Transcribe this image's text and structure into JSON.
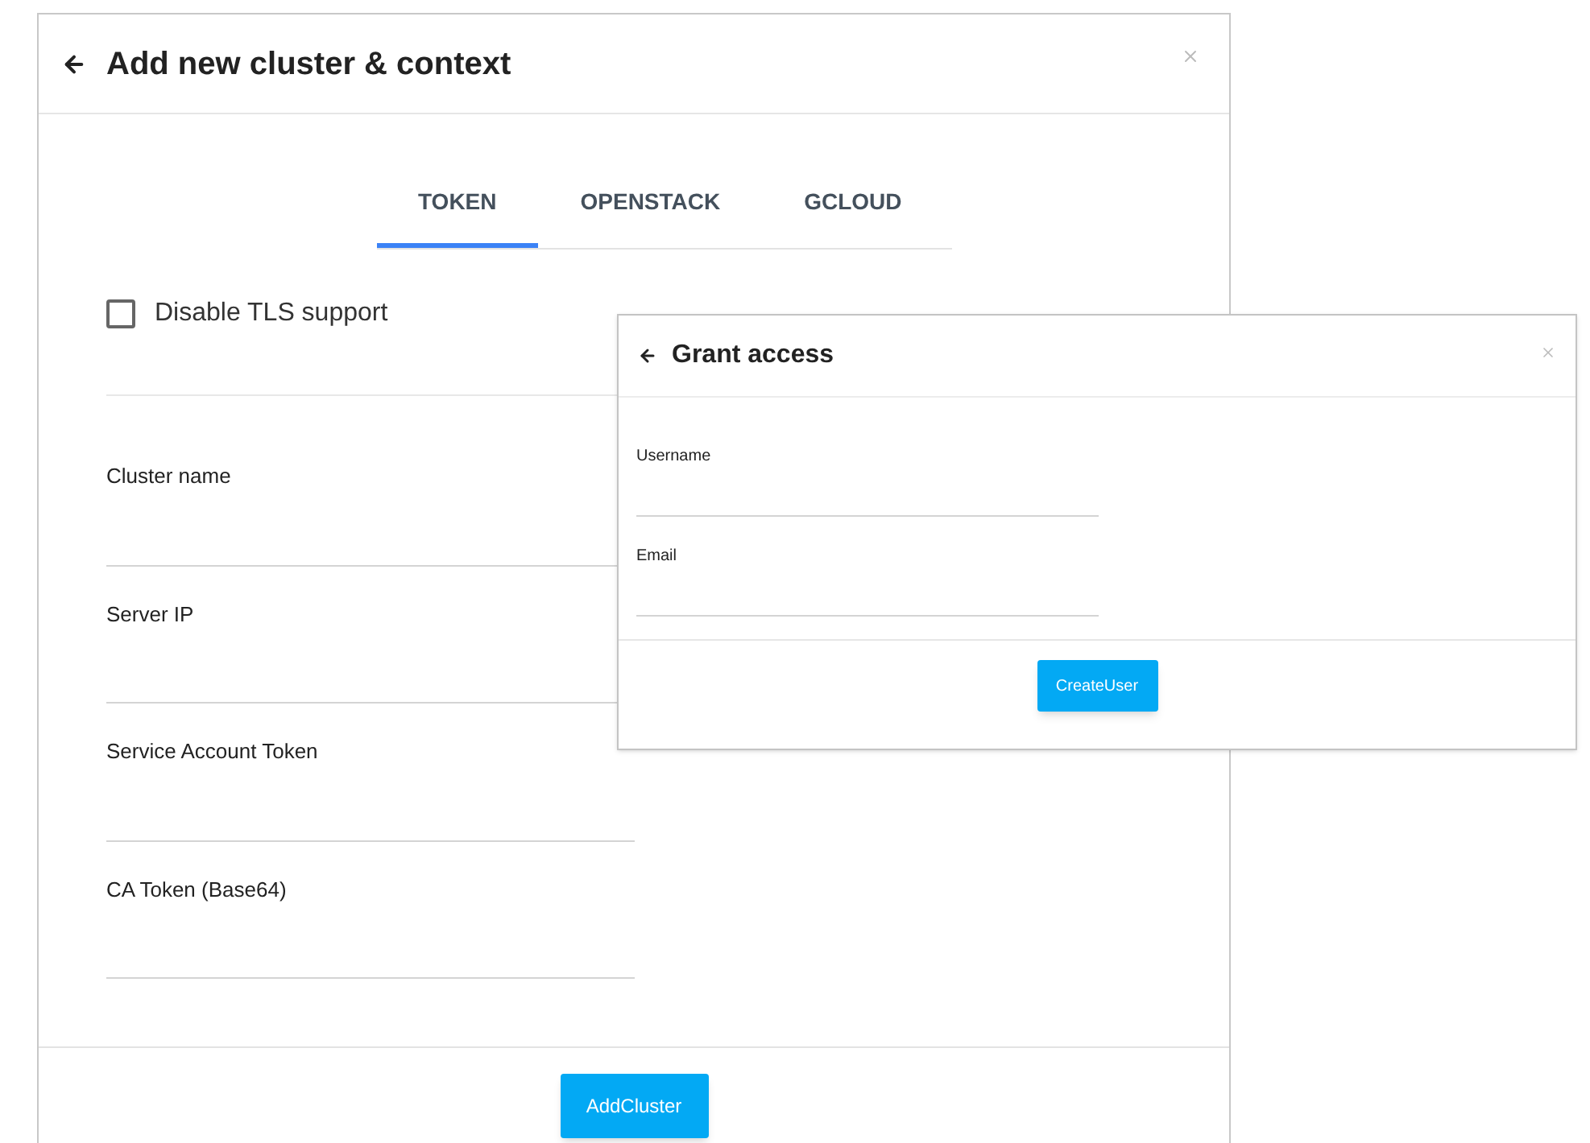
{
  "main_dialog": {
    "title": "Add new cluster & context",
    "tabs": [
      {
        "label": "TOKEN",
        "selected": true
      },
      {
        "label": "OPENSTACK",
        "selected": false
      },
      {
        "label": "GCLOUD",
        "selected": false
      }
    ],
    "checkbox": {
      "label": "Disable TLS support",
      "checked": false
    },
    "fields": [
      {
        "label": "Cluster name"
      },
      {
        "label": "Server IP"
      },
      {
        "label": "Service Account Token"
      },
      {
        "label": "CA Token (Base64)"
      }
    ],
    "button": "AddCluster"
  },
  "grant_dialog": {
    "title": "Grant access",
    "fields": [
      {
        "label": "Username"
      },
      {
        "label": "Email"
      }
    ],
    "button": "CreateUser"
  }
}
